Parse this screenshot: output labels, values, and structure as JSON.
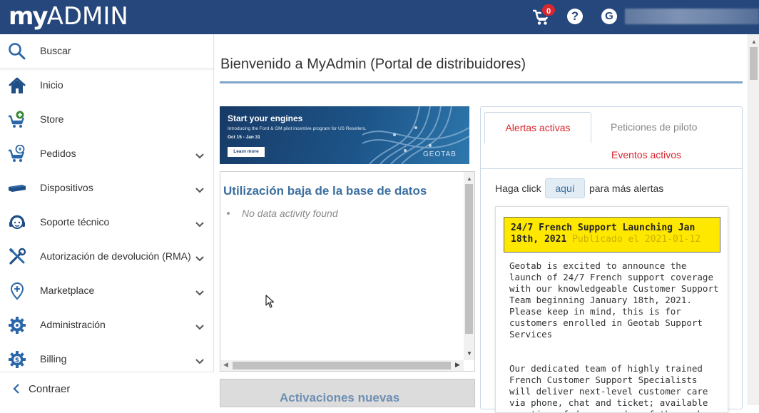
{
  "header": {
    "logo_my": "my",
    "logo_admin": "ADMIN",
    "cart_icon": "cart-icon",
    "cart_count": "0",
    "help_glyph": "?",
    "user_glyph": "G",
    "colors": {
      "bar": "#25477b",
      "badge": "#d9262f"
    }
  },
  "sidebar": {
    "search_label": "Buscar",
    "items": [
      {
        "label": "Inicio",
        "icon": "home-icon"
      },
      {
        "label": "Store",
        "icon": "cart-plus-icon"
      },
      {
        "label": "Pedidos",
        "icon": "cart-g-icon"
      },
      {
        "label": "Dispositivos",
        "icon": "device-icon"
      },
      {
        "label": "Soporte técnico",
        "icon": "headset-icon"
      },
      {
        "label": "Autorización de devolución (RMA)",
        "icon": "tools-icon"
      },
      {
        "label": "Marketplace",
        "icon": "marketplace-icon"
      },
      {
        "label": "Administración",
        "icon": "gear-icon"
      },
      {
        "label": "Billing",
        "icon": "billing-gear-icon"
      }
    ],
    "collapse_label": "Contraer"
  },
  "main": {
    "title": "Bienvenido a MyAdmin (Portal de distribuidores)",
    "banner": {
      "title": "Start your engines",
      "subtitle": "Introducing the Ford & GM pilot incentive program for US Resellers.",
      "dates": "Oct 15 - Jan 31",
      "button": "Learn more",
      "brand": "GEOTAB"
    },
    "db_panel": {
      "title": "Utilización baja de la base de datos",
      "empty": "No data activity found"
    },
    "activations_panel": {
      "title": "Activaciones nuevas"
    }
  },
  "alerts": {
    "tabs": {
      "active": "Alertas activas",
      "pilot": "Peticiones de piloto",
      "events": "Eventos activos"
    },
    "click_prefix": "Haga click",
    "click_button": "aquí",
    "click_suffix": "para más alertas",
    "news": {
      "headline": "24/7 French Support Launching Jan 18th, 2021",
      "published": "Publicado el 2021-01-12",
      "paragraph1": "Geotab is excited to announce the launch of 24/7 French support coverage with our knowledgeable Customer Support Team beginning January 18th, 2021. Please keep in mind, this is for customers enrolled in Geotab Support Services",
      "paragraph2": "Our dedicated team of highly trained French Customer Support Specialists will deliver next-level customer care via phone, chat and ticket; available any time of day, any day of the week, excluding Canadian"
    }
  }
}
